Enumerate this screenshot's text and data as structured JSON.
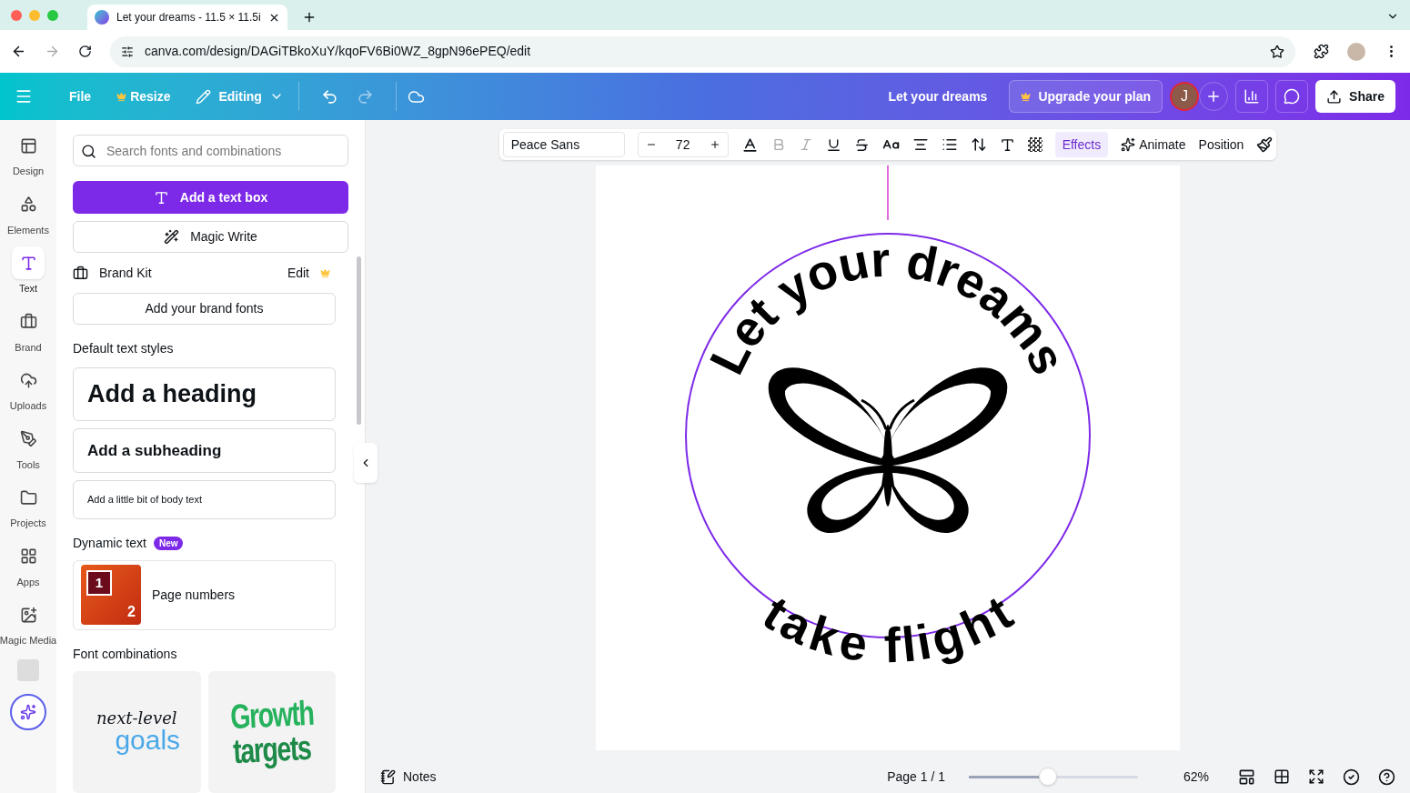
{
  "browser": {
    "tab_title": "Let your dreams - 11.5 × 11.5i",
    "url": "canva.com/design/DAGiTBkoXuY/kqoFV6Bi0WZ_8gpN96ePEQ/edit"
  },
  "header": {
    "menu": [
      {
        "label": "File",
        "crown": false
      },
      {
        "label": "Resize",
        "crown": true
      }
    ],
    "mode": "Editing",
    "design_title": "Let your dreams",
    "upgrade": "Upgrade your plan",
    "avatar": "J",
    "share": "Share"
  },
  "rail": [
    {
      "label": "Design",
      "selected": false
    },
    {
      "label": "Elements",
      "selected": false
    },
    {
      "label": "Text",
      "selected": true
    },
    {
      "label": "Brand",
      "selected": false
    },
    {
      "label": "Uploads",
      "selected": false
    },
    {
      "label": "Tools",
      "selected": false
    },
    {
      "label": "Projects",
      "selected": false
    },
    {
      "label": "Apps",
      "selected": false
    },
    {
      "label": "Magic Media",
      "selected": false
    }
  ],
  "panel": {
    "search": {
      "placeholder": "Search fonts and combinations"
    },
    "add_text_box": "Add a text box",
    "magic_write": "Magic Write",
    "brand_kit": "Brand Kit",
    "brand_edit": "Edit",
    "brand_fonts": "Add your brand fonts",
    "default_styles_title": "Default text styles",
    "styles": [
      {
        "kind": "heading",
        "label": "Add a heading"
      },
      {
        "kind": "subheading",
        "label": "Add a subheading"
      },
      {
        "kind": "body",
        "label": "Add a little bit of body text"
      }
    ],
    "dynamic_title": "Dynamic text",
    "dynamic_badge": "New",
    "page_numbers": {
      "label": "Page numbers",
      "first": "1",
      "second": "2"
    },
    "combos_title": "Font combinations",
    "combos": [
      {
        "kind": "script",
        "top": "next-level",
        "bottom": "goals"
      },
      {
        "kind": "condensed",
        "top": "Growth",
        "bottom": "targets"
      }
    ]
  },
  "toolbar": {
    "font": "Peace Sans",
    "size": "72",
    "effects": "Effects",
    "animate": "Animate",
    "position": "Position"
  },
  "design": {
    "top_text": "Let your dreams",
    "bottom_text": "take flight"
  },
  "footer": {
    "notes": "Notes",
    "page": "Page 1 / 1",
    "zoom": {
      "level": 0.47
    },
    "zoom_label": "62%"
  }
}
